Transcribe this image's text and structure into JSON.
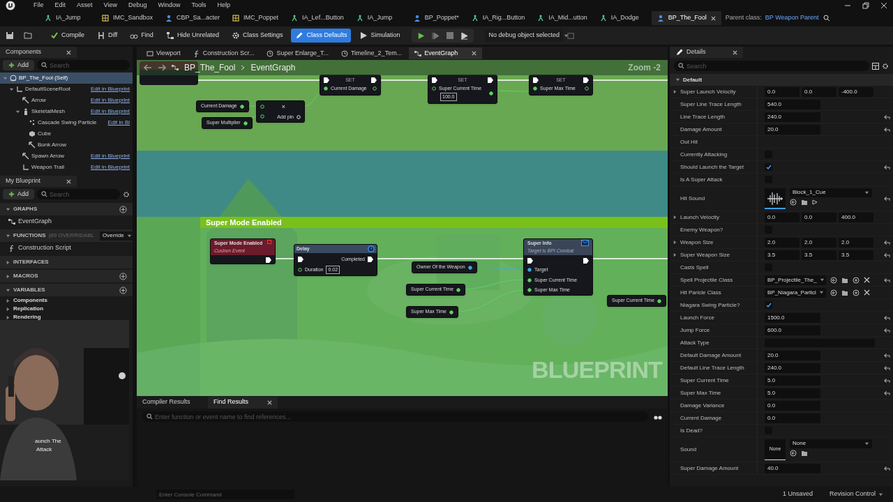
{
  "menu": [
    "File",
    "Edit",
    "Asset",
    "View",
    "Debug",
    "Window",
    "Tools",
    "Help"
  ],
  "doc_tabs": [
    {
      "label": "IA_Jump",
      "kind": "input",
      "selected": false
    },
    {
      "label": "IMC_Sandbox",
      "kind": "mapping",
      "selected": false
    },
    {
      "label": "CBP_Sa...acter",
      "kind": "blueprint",
      "selected": false
    },
    {
      "label": "IMC_Poppet",
      "kind": "mapping",
      "selected": false
    },
    {
      "label": "IA_Lef...Button",
      "kind": "input",
      "selected": false
    },
    {
      "label": "IA_Jump",
      "kind": "input",
      "selected": false
    },
    {
      "label": "BP_Poppet*",
      "kind": "blueprint",
      "selected": false
    },
    {
      "label": "IA_Rig...Button",
      "kind": "input",
      "selected": false
    },
    {
      "label": "IA_Mid...utton",
      "kind": "input",
      "selected": false
    },
    {
      "label": "IA_Dodge",
      "kind": "input",
      "selected": false
    },
    {
      "label": "BP_The_Fool",
      "kind": "blueprint",
      "selected": true
    }
  ],
  "parent_class": {
    "label": "Parent class:",
    "value": "BP Weapon Parent"
  },
  "toolbar": [
    {
      "label": "Compile",
      "kind": "compile",
      "selected": false
    },
    {
      "label": "Diff",
      "kind": "diff",
      "selected": false
    },
    {
      "label": "Find",
      "kind": "find",
      "selected": false
    },
    {
      "label": "Hide Unrelated",
      "kind": "hide",
      "selected": false
    },
    {
      "label": "Class Settings",
      "kind": "settings",
      "selected": false
    },
    {
      "label": "Class Defaults",
      "kind": "defaults",
      "selected": true
    },
    {
      "label": "Simulation",
      "kind": "simulation",
      "selected": false
    }
  ],
  "debug_selector": "No debug object selected",
  "components": {
    "title": "Components",
    "add": "Add",
    "search_placeholder": "Search",
    "tree": [
      {
        "name": "BP_The_Fool (Self)",
        "kind": "self",
        "selected": true,
        "children": [
          {
            "name": "DefaultSceneRoot",
            "kind": "scene",
            "link": "Edit in Blueprint",
            "selected": false,
            "children": [
              {
                "name": "Arrow",
                "kind": "arrow",
                "link": "Edit in Blueprint",
                "selected": false
              },
              {
                "name": "SkeletalMesh",
                "kind": "mesh",
                "link": "Edit in Blueprint",
                "selected": false,
                "children": [
                  {
                    "name": "Cascade Swing Particle",
                    "kind": "particle",
                    "link": "Edit in Bl",
                    "selected": false
                  },
                  {
                    "name": "Cube",
                    "kind": "cube",
                    "selected": false
                  },
                  {
                    "name": "Bonk Arrow",
                    "kind": "arrow",
                    "selected": false
                  }
                ]
              },
              {
                "name": "Spawn Arrow",
                "kind": "arrow",
                "link": "Edit in Blueprint",
                "selected": false
              },
              {
                "name": "Weapon Trail",
                "kind": "scene",
                "link": "Edit in Blueprint",
                "selected": false
              }
            ]
          }
        ]
      }
    ]
  },
  "my_blueprint": {
    "title": "My Blueprint",
    "add": "Add",
    "search_placeholder": "Search",
    "sections": [
      {
        "title": "GRAPHS",
        "expanded": true,
        "items": [
          {
            "label": "EventGraph",
            "kind": "graph"
          }
        ]
      },
      {
        "title": "FUNCTIONS",
        "note": "(69 OVERRIDABL",
        "override": "Override",
        "expanded": true,
        "items": [
          {
            "label": "Construction Script",
            "kind": "function"
          }
        ]
      },
      {
        "title": "INTERFACES",
        "expanded": false
      },
      {
        "title": "MACROS",
        "expanded": false
      },
      {
        "title": "VARIABLES",
        "expanded": true,
        "items": [
          {
            "label": "Components",
            "kind": "category"
          },
          {
            "label": "Replication",
            "kind": "category"
          },
          {
            "label": "Rendering",
            "kind": "category"
          }
        ]
      }
    ]
  },
  "webcam_caption": [
    "aunch The",
    "Attack"
  ],
  "editor_tabs": [
    {
      "label": "Viewport",
      "kind": "viewport",
      "selected": false
    },
    {
      "label": "Construction Scr...",
      "kind": "function",
      "selected": false
    },
    {
      "label": "Super Enlarge_T...",
      "kind": "timeline",
      "selected": false
    },
    {
      "label": "Timeline_2_Tem...",
      "kind": "timeline",
      "selected": false
    },
    {
      "label": "EventGraph",
      "kind": "graph",
      "selected": true
    }
  ],
  "graph": {
    "breadcrumb": [
      "BP_The_Fool",
      "EventGraph"
    ],
    "zoom": "Zoom -2",
    "watermark": "BLUEPRINT",
    "comment": "Super Mode Enabled",
    "nodes": [
      {
        "kind": "set",
        "title": "SET",
        "pin": "Current Damage"
      },
      {
        "kind": "set",
        "title": "SET",
        "pin": "Super Current Time",
        "value": "100.0"
      },
      {
        "kind": "set",
        "title": "SET",
        "pin": "Super Max Time"
      },
      {
        "kind": "get",
        "title": "Current Damage"
      },
      {
        "kind": "get",
        "title": "Super Multiplier"
      },
      {
        "kind": "multiply",
        "title": "×",
        "pin": "Add pin"
      },
      {
        "kind": "event",
        "title": "Super Mode Enabled",
        "subtitle": "Custom Event"
      },
      {
        "kind": "delay",
        "title": "Delay",
        "out": "Completed",
        "pin": "Duration",
        "value": "0.02"
      },
      {
        "kind": "get",
        "title": "Owner Of the Weapon",
        "color": "#3fa9e0"
      },
      {
        "kind": "get",
        "title": "Super Current Time"
      },
      {
        "kind": "get",
        "title": "Super Max Time"
      },
      {
        "kind": "message",
        "title": "Super Info",
        "subtitle": "Target is BPI Combat",
        "pins": [
          "Target",
          "Super Current Time",
          "Super Max Time"
        ]
      },
      {
        "kind": "get",
        "title": "Super Current Time"
      }
    ]
  },
  "bottom_tabs": [
    {
      "label": "Compiler Results",
      "selected": false
    },
    {
      "label": "Find Results",
      "selected": true
    }
  ],
  "find_placeholder": "Enter function or event name to find references...",
  "details": {
    "title": "Details",
    "search_placeholder": "Search",
    "category": "Default",
    "rows": [
      {
        "label": "Super Launch Velocity",
        "kind": "vector",
        "values": [
          "0.0",
          "0.0",
          "-400.0"
        ],
        "expandable": true,
        "reset": false
      },
      {
        "label": "Super Line Trace Length",
        "kind": "number",
        "value": "540.0",
        "reset": false
      },
      {
        "label": "Line Trace Length",
        "kind": "number",
        "value": "240.0",
        "reset": true
      },
      {
        "label": "Damage Amount",
        "kind": "number",
        "value": "20.0",
        "reset": true
      },
      {
        "label": "Out Hit",
        "kind": "empty",
        "reset": false
      },
      {
        "label": "Currently Attacking",
        "kind": "checkbox",
        "checked": false,
        "reset": false
      },
      {
        "label": "Should Launch the Target",
        "kind": "checkbox",
        "checked": true,
        "reset": true
      },
      {
        "label": "Is A Super Attack",
        "kind": "checkbox",
        "checked": false,
        "reset": false
      },
      {
        "label": "Hit Sound",
        "kind": "asset",
        "value": "Block_1_Cue",
        "reset": true
      },
      {
        "label": "Launch Velocity",
        "kind": "vector",
        "values": [
          "0.0",
          "0.0",
          "400.0"
        ],
        "expandable": true,
        "reset": false
      },
      {
        "label": "Enemy Weapon?",
        "kind": "checkbox",
        "checked": false,
        "reset": false
      },
      {
        "label": "Weapon Size",
        "kind": "vector",
        "values": [
          "2.0",
          "2.0",
          "2.0"
        ],
        "expandable": true,
        "reset": true
      },
      {
        "label": "Super Weapon Size",
        "kind": "vector",
        "values": [
          "3.5",
          "3.5",
          "3.5"
        ],
        "expandable": true,
        "reset": true
      },
      {
        "label": "Casts Spell",
        "kind": "checkbox",
        "checked": false,
        "reset": false
      },
      {
        "label": "Spell Projectile Class",
        "kind": "class",
        "value": "BP_Projectile_The_",
        "reset": true
      },
      {
        "label": "Hit Paricle Class",
        "kind": "class",
        "value": "BP_Niagara_Particl",
        "reset": false
      },
      {
        "label": "Niagara Swing Particle?",
        "kind": "checkbox",
        "checked": true,
        "reset": false
      },
      {
        "label": "Launch Force",
        "kind": "number",
        "value": "1500.0",
        "reset": true
      },
      {
        "label": "Jump Force",
        "kind": "number",
        "value": "600.0",
        "reset": true
      },
      {
        "label": "Attack Type",
        "kind": "wide",
        "reset": false
      },
      {
        "label": "Default Damage Amount",
        "kind": "number",
        "value": "20.0",
        "reset": true
      },
      {
        "label": "Default Line Trace Length",
        "kind": "number",
        "value": "240.0",
        "reset": true
      },
      {
        "label": "Super Current Time",
        "kind": "number",
        "value": "5.0",
        "reset": true
      },
      {
        "label": "Super Max Time",
        "kind": "number",
        "value": "5.0",
        "reset": true
      },
      {
        "label": "Damage Variance",
        "kind": "number",
        "value": "0.0",
        "reset": false
      },
      {
        "label": "Current Damage",
        "kind": "number",
        "value": "0.0",
        "reset": false
      },
      {
        "label": "Is Dead?",
        "kind": "checkbox",
        "checked": false,
        "reset": false
      },
      {
        "label": "Sound",
        "kind": "asset",
        "value": "None",
        "thumb_text": "None",
        "reset": false
      },
      {
        "label": "Super Damage Amount",
        "kind": "number",
        "value": "40.0",
        "reset": true
      }
    ]
  },
  "status": {
    "console_placeholder": "Enter Console Command",
    "unsaved": "1 Unsaved",
    "revision": "Revision Control"
  }
}
